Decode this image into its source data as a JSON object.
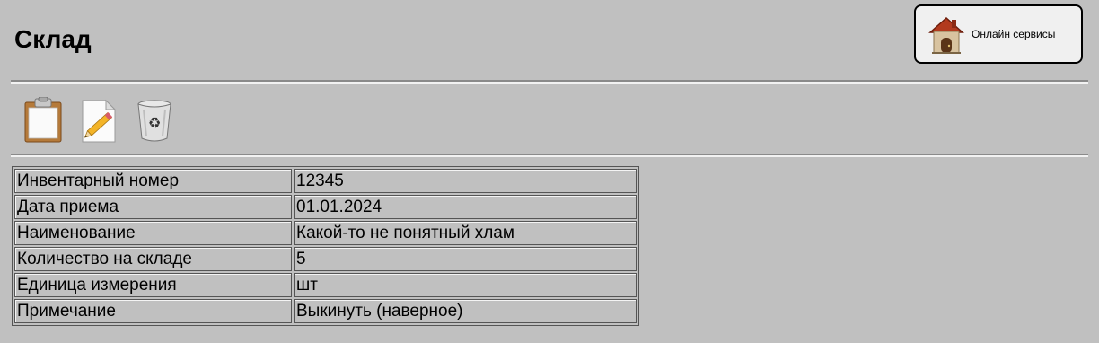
{
  "page": {
    "title": "Склад"
  },
  "header": {
    "online_services": {
      "label": "Онлайн сервисы",
      "icon": "house-icon"
    }
  },
  "toolbar": {
    "items": [
      {
        "icon": "clipboard-icon"
      },
      {
        "icon": "edit-document-icon"
      },
      {
        "icon": "recycle-bin-icon"
      }
    ]
  },
  "details": {
    "rows": [
      {
        "label": "Инвентарный номер",
        "value": "12345"
      },
      {
        "label": "Дата приема",
        "value": "01.01.2024"
      },
      {
        "label": "Наименование",
        "value": "Какой-то не понятный хлам"
      },
      {
        "label": "Количество на складе",
        "value": "5"
      },
      {
        "label": "Единица измерения",
        "value": "шт"
      },
      {
        "label": "Примечание",
        "value": "Выкинуть (наверное)"
      }
    ]
  },
  "colors": {
    "background": "#c0c0c0",
    "button_background": "#f0f0f0"
  }
}
